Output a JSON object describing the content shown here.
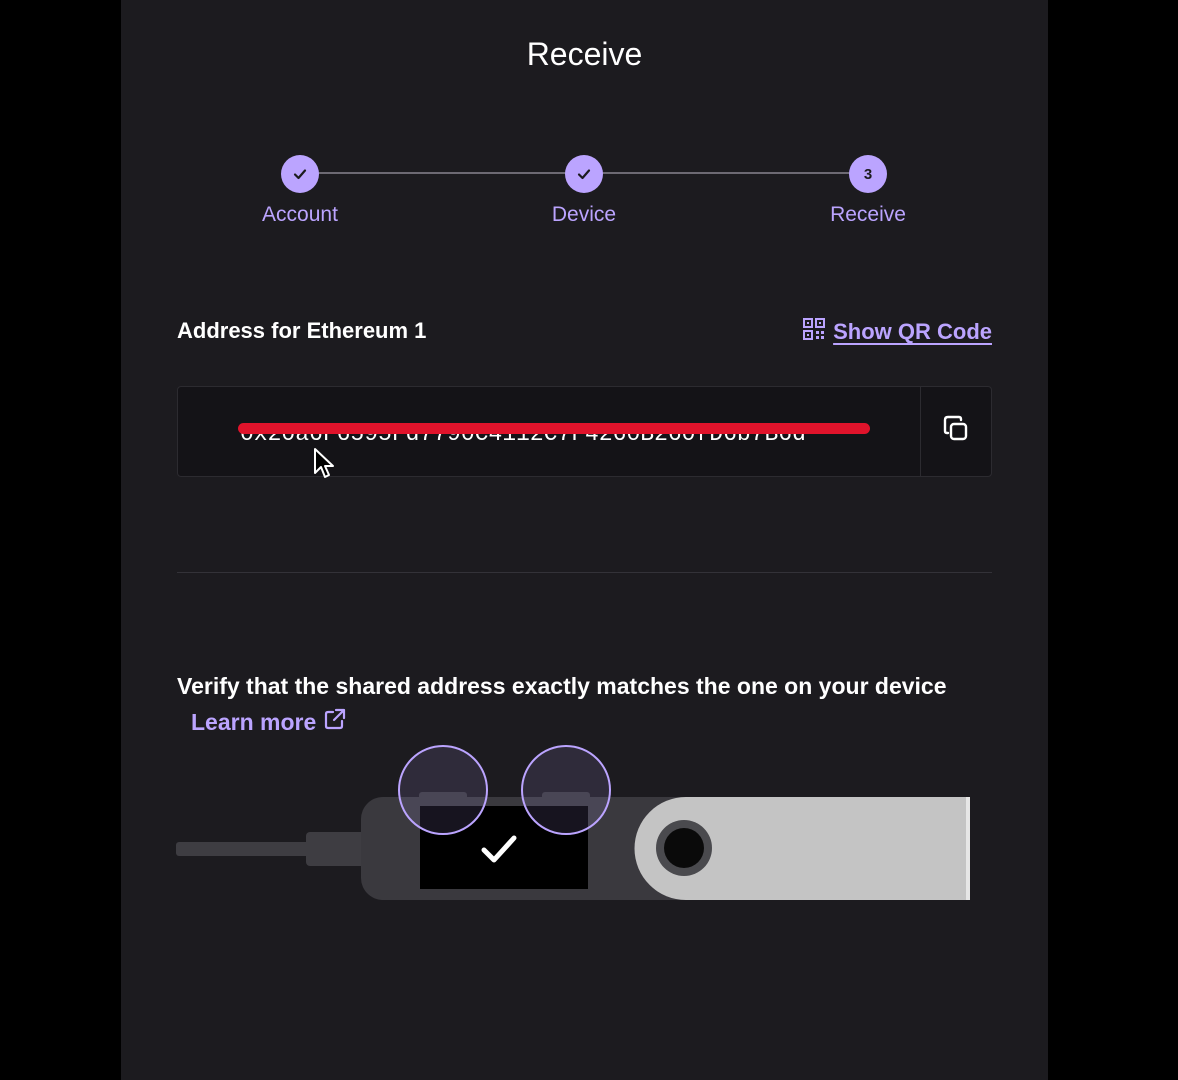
{
  "header": {
    "title": "Receive"
  },
  "stepper": {
    "steps": [
      {
        "label": "Account",
        "state": "done"
      },
      {
        "label": "Device",
        "state": "done"
      },
      {
        "label": "Receive",
        "number": "3",
        "state": "current"
      }
    ]
  },
  "address": {
    "title": "Address for Ethereum 1",
    "show_qr_label": "Show QR Code",
    "value": "0x20a6F6595Fd7790C4112C7F4260B260fD6b7B6d",
    "copy_icon": "copy-icon"
  },
  "verify": {
    "text": "Verify that the shared address exactly matches the one on your device",
    "learn_more": "Learn more"
  },
  "colors": {
    "accent": "#bba4ff",
    "background": "#1c1b1f",
    "redaction": "#e0132b"
  }
}
